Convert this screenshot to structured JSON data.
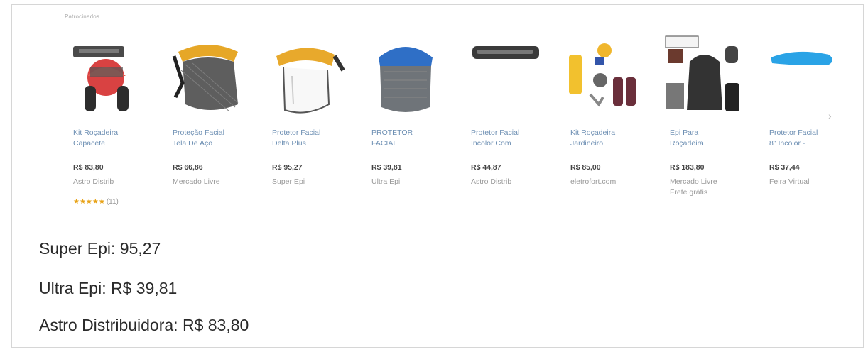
{
  "ad": {
    "sponsored_label": "Patrocinados"
  },
  "products": [
    {
      "title": "Kit Roçadeira\nCapacete",
      "price": "R$ 83,80",
      "seller": "Astro Distrib",
      "rating": "★★★★★",
      "rating_count": "(11)",
      "icon": "chainsaw-helmet-kit-image"
    },
    {
      "title": "Proteção Facial\nTela De Aço",
      "price": "R$ 66,86",
      "seller": "Mercado Livre",
      "icon": "mesh-face-shield-image"
    },
    {
      "title": "Protetor Facial\nDelta Plus",
      "price": "R$ 95,27",
      "seller": "Super Epi",
      "icon": "clear-face-shield-image"
    },
    {
      "title": "PROTETOR\nFACIAL",
      "price": "R$ 39,81",
      "seller": "Ultra Epi",
      "icon": "blue-face-shield-image"
    },
    {
      "title": "Protetor Facial\nIncolor Com",
      "price": "R$ 44,87",
      "seller": "Astro Distrib",
      "icon": "visor-image"
    },
    {
      "title": "Kit Roçadeira\nJardineiro",
      "price": "R$ 85,00",
      "seller": "eletrofort.com",
      "icon": "garden-kit-image"
    },
    {
      "title": "Epi Para\nRoçadeira",
      "price": "R$ 183,80",
      "seller": "Mercado Livre\nFrete grátis",
      "icon": "ppe-kit-image"
    },
    {
      "title": "Protetor Facial\n8\" Incolor -",
      "price": "R$ 37,44",
      "seller": "Feira Virtual",
      "icon": "blue-visor-image"
    }
  ],
  "summary": [
    "Super Epi: 95,27",
    "Ultra Epi: R$ 39,81",
    "Astro Distribuidora: R$ 83,80"
  ]
}
